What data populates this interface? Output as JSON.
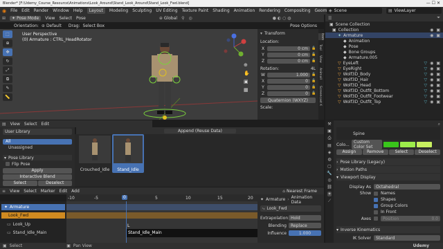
{
  "titlebar": {
    "text": "Blender* [F:\\Udemy_Course_Resource\\Animations\\Look_Around\\Stand_Look_Around\\Stand_Look_Fwd.blend]"
  },
  "menu": [
    "File",
    "Edit",
    "Render",
    "Window",
    "Help"
  ],
  "workspaces": [
    "Layout",
    "Modeling",
    "Sculpting",
    "UV Editing",
    "Texture Paint",
    "Shading",
    "Animation",
    "Rendering",
    "Compositing",
    "Geometry Nodes",
    "S"
  ],
  "scene": {
    "name": "Scene",
    "viewlayer": "ViewLayer"
  },
  "viewport_header": {
    "mode": "Pose Mode",
    "menus": [
      "View",
      "Select",
      "Pose"
    ],
    "transform": "Global"
  },
  "viewport_header2": {
    "orientation_label": "Orientation:",
    "orientation": "Default",
    "drag_label": "Drag:",
    "drag": "Select Box",
    "pose_options": "Pose Options"
  },
  "viewport": {
    "view_name": "User Perspective",
    "context": "(0) Armature : CTRL_HeadRotator"
  },
  "npanel": {
    "title": "Transform",
    "location_label": "Location:",
    "loc": [
      "0 cm",
      "0 cm",
      "0 cm"
    ],
    "rotation_label": "Rotation:",
    "rot": [
      "1.000",
      "0",
      "0",
      "0"
    ],
    "rot_axes": [
      "W",
      "X",
      "Y",
      "Z"
    ],
    "loc_axes": [
      "X",
      "Y",
      "Z"
    ],
    "mode": "Quaternion (WXYZ)",
    "scale_label": "Scale:",
    "rot_lock": "4L",
    "tabs": [
      "Item",
      "Tool",
      "View",
      "Animall",
      "Screencast K"
    ]
  },
  "outliner": {
    "items": [
      {
        "label": "Collection",
        "level": 0
      },
      {
        "label": "Armature",
        "level": 1
      },
      {
        "label": "Animation",
        "level": 2
      },
      {
        "label": "Pose",
        "level": 2
      },
      {
        "label": "Bone Groups",
        "level": 2
      },
      {
        "label": "Armature.005",
        "level": 2
      },
      {
        "label": "EyeLeft",
        "level": 1
      },
      {
        "label": "EyeRight",
        "level": 1
      },
      {
        "label": "Wolf3D_Body",
        "level": 1
      },
      {
        "label": "Wolf3D_Hair",
        "level": 1
      },
      {
        "label": "Wolf3D_Head",
        "level": 1
      },
      {
        "label": "Wolf3D_Outfit_Bottom",
        "level": 1
      },
      {
        "label": "Wolf3D_Outfit_Footwear",
        "level": 1
      },
      {
        "label": "Wolf3D_Outfit_Top",
        "level": 1
      }
    ]
  },
  "asset_browser": {
    "menus": [
      "View",
      "Select",
      "Edit"
    ],
    "title": "Append (Reuse Data)",
    "library": "User Library",
    "catalogs": [
      "All",
      "Unassigned"
    ],
    "assets": [
      "Crouched_Idle",
      "Stand_Idle"
    ]
  },
  "pose_library": {
    "title": "Pose Library",
    "flip": "Flip Pose",
    "apply": "Apply",
    "blend": "Interactive Blend",
    "select": "Select",
    "deselect": "Deselect"
  },
  "props": {
    "bone_label": "Spine",
    "color_label": "Colo...",
    "color_set": "Custom Color Set",
    "assign": "Assign",
    "remove": "Remove",
    "select": "Select",
    "deselect": "Deselect",
    "sections": [
      "Pose Library (Legacy)",
      "Motion Paths",
      "Viewport Display"
    ],
    "display_as_label": "Display As",
    "display_as": "Octahedral",
    "show_label": "Show",
    "names": "Names",
    "shapes": "Shapes",
    "group_colors": "Group Colors",
    "in_front": "In Front",
    "axes_label": "Axes",
    "position_label": "Position",
    "position": "0.0",
    "ik_section": "Inverse Kinematics",
    "ik_solver_label": "IK Solver",
    "ik_solver": "Standard"
  },
  "timeline": {
    "menus": [
      "View",
      "Select",
      "Marker",
      "Edit",
      "Add"
    ],
    "frames": [
      "-10",
      "-5",
      "0",
      "5",
      "10",
      "15",
      "20"
    ],
    "current": "0",
    "snap": "Nearest Frame",
    "tracks": [
      "Armature",
      "Look_Fwd",
      "Look_Up",
      "Stand_Idle_Main"
    ],
    "strip": "Stand_Idle_Main",
    "marker": "L"
  },
  "nla_side": {
    "context": "Armature",
    "data": "Animation Data",
    "action": "Look_Fwd",
    "extrapolation_label": "Extrapolation",
    "extrapolation": "Hold",
    "blending_label": "Blending",
    "blending": "Replace",
    "influence_label": "Influence",
    "influence": "1.000"
  },
  "statusbar": {
    "items": [
      "Select",
      "Pan View"
    ],
    "brand": "Udemy"
  }
}
